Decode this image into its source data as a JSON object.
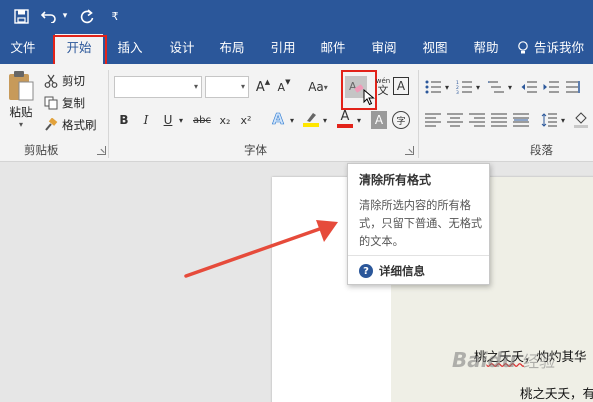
{
  "colors": {
    "accent": "#2b579a",
    "highlight_box": "#e2231a",
    "arrow": "#e64b3b",
    "font_color_bar": "#e2231a",
    "highlight_bar": "#ffe600"
  },
  "quick_access": {
    "dropdown_glyph": "▾",
    "customize_glyph": "₹"
  },
  "tabs": [
    {
      "label": "文件"
    },
    {
      "label": "开始"
    },
    {
      "label": "插入"
    },
    {
      "label": "设计"
    },
    {
      "label": "布局"
    },
    {
      "label": "引用"
    },
    {
      "label": "邮件"
    },
    {
      "label": "审阅"
    },
    {
      "label": "视图"
    },
    {
      "label": "帮助"
    }
  ],
  "tell_me": {
    "label": "告诉我你"
  },
  "clipboard": {
    "paste_label": "粘贴",
    "cut_label": "剪切",
    "copy_label": "复制",
    "format_painter_label": "格式刷",
    "group_label": "剪贴板"
  },
  "font": {
    "font_name_value": "",
    "font_size_value": "",
    "grow_label": "A",
    "shrink_label": "A",
    "case_label": "Aa",
    "pinyin_label": "wén",
    "border_char_label": "A",
    "bold_label": "B",
    "italic_label": "I",
    "underline_label": "U",
    "strike_label": "abc",
    "subscript_label": "x₂",
    "superscript_label": "x²",
    "effects_label": "A",
    "font_color_label": "A",
    "shading_label": "A",
    "enclose_label": "字",
    "group_label": "字体"
  },
  "paragraph": {
    "group_label": "段落"
  },
  "tooltip": {
    "title": "清除所有格式",
    "body": "清除所选内容的所有格式，只留下普通、无格式的文本。",
    "help_label": "详细信息",
    "help_glyph": "?"
  },
  "document": {
    "line1_prefix": "桃",
    "line1_squiggle": "之夭夭",
    "line1_rest": "，灼灼其华",
    "line2": "桃之夭夭，有"
  },
  "watermark": {
    "brand": "Bai",
    "paw": "du",
    "suffix": "经验"
  }
}
